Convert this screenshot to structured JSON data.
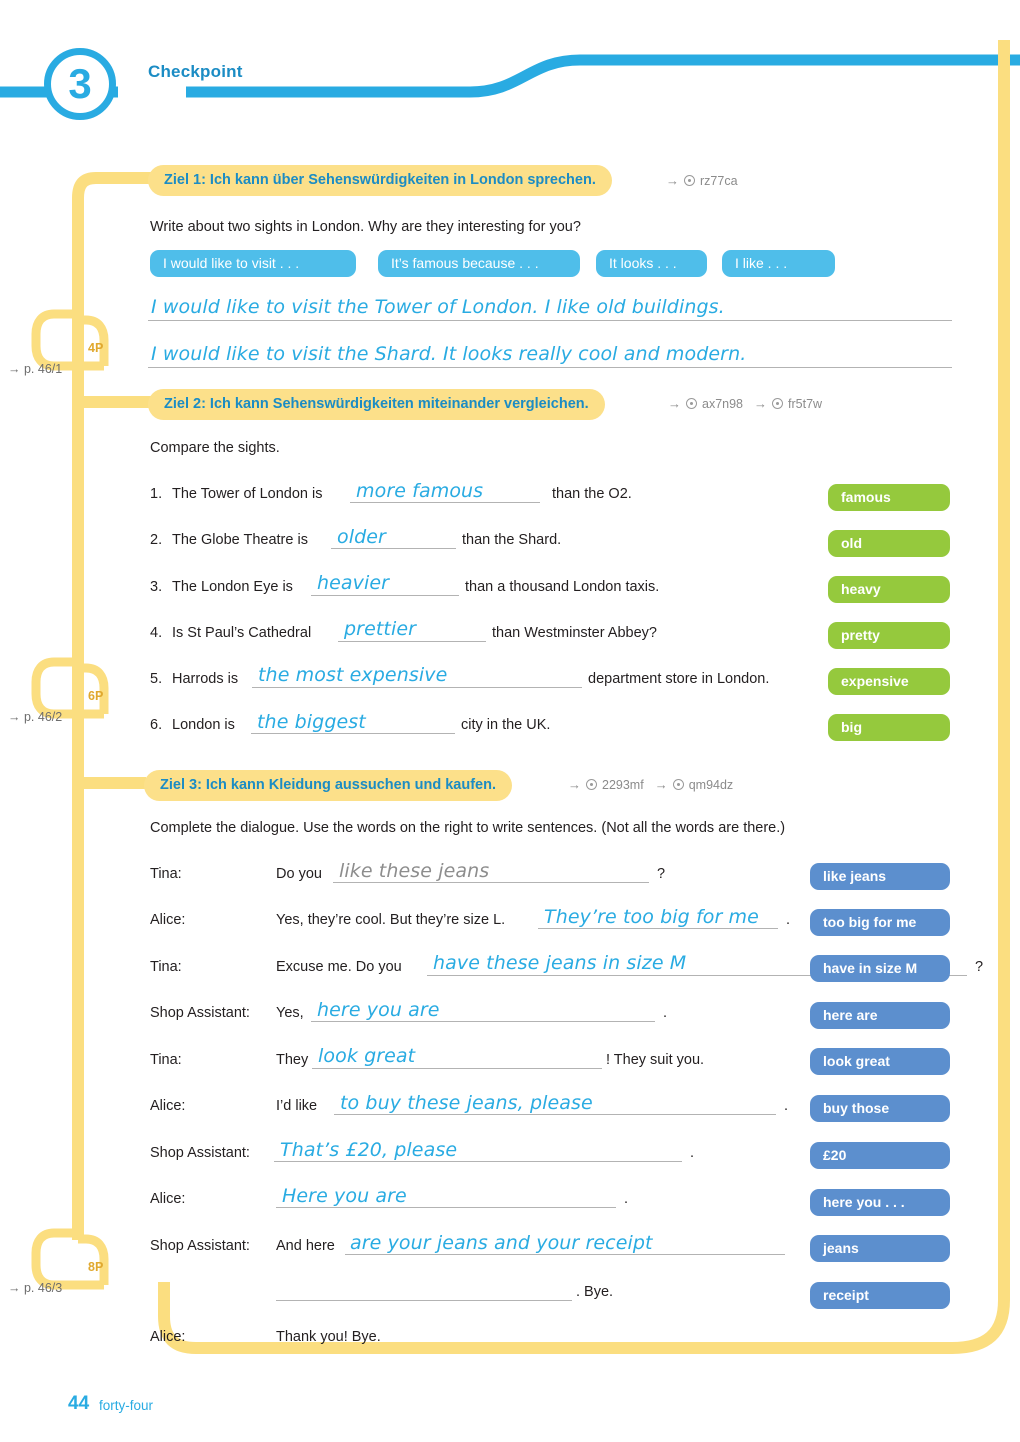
{
  "header": {
    "unit_number": "3",
    "title": "Checkpoint",
    "accent_blue": "#29ABE2",
    "accent_yellow": "#FCE08A"
  },
  "sections": [
    {
      "id": "ziel1",
      "label": "Ziel 1: Ich kann über Sehenswürdigkeiten in London sprechen.",
      "codes": [
        "rz77ca"
      ],
      "instruction": "Write about two sights in London. Why are they interesting for you?",
      "starters": [
        "I would like to visit . . .",
        "It’s famous because . . .",
        "It looks . . .",
        "I like . . ."
      ],
      "answers": [
        "I would like to visit the Tower of London. I like old buildings.",
        "I would like to visit the Shard. It looks really cool and modern."
      ],
      "points": "4P",
      "page_ref": "→ p. 46/1"
    },
    {
      "id": "ziel2",
      "label": "Ziel 2: Ich kann Sehenswürdigkeiten miteinander vergleichen.",
      "codes": [
        "ax7n98",
        "fr5t7w"
      ],
      "instruction": "Compare the sights.",
      "items": [
        {
          "num": "1.",
          "before": "The Tower of London is",
          "answer": "more famous",
          "after": "than the O2.",
          "word": "famous"
        },
        {
          "num": "2.",
          "before": "The Globe Theatre is",
          "answer": "older",
          "after": "than the Shard.",
          "word": "old"
        },
        {
          "num": "3.",
          "before": "The London Eye is",
          "answer": "heavier",
          "after": "than a thousand London taxis.",
          "word": "heavy"
        },
        {
          "num": "4.",
          "before": "Is St Paul’s Cathedral",
          "answer": "prettier",
          "after": "than Westminster Abbey?",
          "word": "pretty"
        },
        {
          "num": "5.",
          "before": "Harrods is",
          "answer": "the most expensive",
          "after": "department store in London.",
          "word": "expensive"
        },
        {
          "num": "6.",
          "before": "London is",
          "answer": "the biggest",
          "after": "city in the UK.",
          "word": "big"
        }
      ],
      "points": "6P",
      "page_ref": "→ p. 46/2"
    },
    {
      "id": "ziel3",
      "label": "Ziel 3: Ich kann Kleidung aussuchen und kaufen.",
      "codes": [
        "2293mf",
        "qm94dz"
      ],
      "instruction": "Complete the dialogue. Use the words on the right to write sentences. (Not all the words are there.)",
      "dialogue": [
        {
          "speaker": "Tina:",
          "before": "Do you",
          "answer": "like these jeans",
          "answer_style": "grey",
          "after": "?",
          "word": "like jeans"
        },
        {
          "speaker": "Alice:",
          "before": "Yes, they’re cool. But they’re size L.",
          "answer": "They’re too big for me",
          "answer_style": "blue",
          "after": ".",
          "word": "too big for me"
        },
        {
          "speaker": "Tina:",
          "before": "Excuse me. Do you",
          "answer": "have these jeans in size M",
          "answer_style": "blue",
          "after": "?",
          "word": "have in size M"
        },
        {
          "speaker": "Shop Assistant:",
          "before": "Yes,",
          "answer": "here you are",
          "answer_style": "blue",
          "after": ".",
          "word": "here are"
        },
        {
          "speaker": "Tina:",
          "before": "They",
          "answer": "look great",
          "answer_style": "blue",
          "after": "! They suit you.",
          "word": "look great"
        },
        {
          "speaker": "Alice:",
          "before": "I’d like",
          "answer": "to buy these jeans, please",
          "answer_style": "blue",
          "after": ".",
          "word": "buy those"
        },
        {
          "speaker": "Shop Assistant:",
          "before": "",
          "answer": "That’s £20, please",
          "answer_style": "blue",
          "after": ".",
          "word": "£20"
        },
        {
          "speaker": "Alice:",
          "before": "",
          "answer": "Here you are",
          "answer_style": "blue",
          "after": ".",
          "word": "here you . . ."
        },
        {
          "speaker": "Shop Assistant:",
          "before": "And here",
          "answer": "are your jeans and your receipt",
          "answer_style": "blue",
          "after": "",
          "word": "jeans"
        },
        {
          "speaker": "",
          "before": "",
          "answer": "",
          "answer_style": "blue",
          "after": ". Bye.",
          "word": "receipt"
        },
        {
          "speaker": "Alice:",
          "before": "Thank you! Bye.",
          "answer": "",
          "answer_style": "blue",
          "after": "",
          "word": ""
        }
      ],
      "points": "8P",
      "page_ref": "→ p. 46/3"
    }
  ],
  "footer": {
    "page_number": "44",
    "page_word": "forty-four"
  },
  "icons": {
    "code_disc": "media-disc-icon",
    "arrow": "→"
  }
}
